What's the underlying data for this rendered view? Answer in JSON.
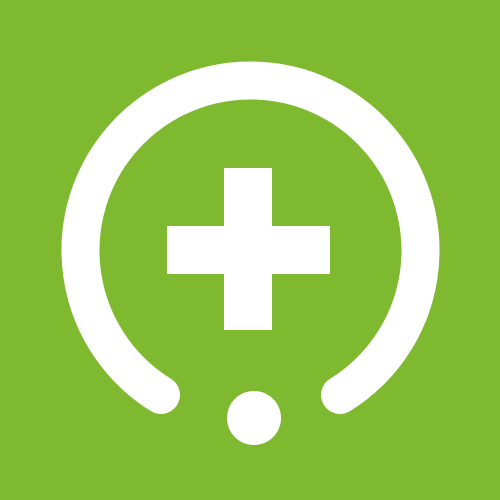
{
  "app_icon": {
    "icon": "medical-cross-ring-icon",
    "colors": {
      "background": "#7fb92f",
      "foreground": "#ffffff"
    }
  }
}
